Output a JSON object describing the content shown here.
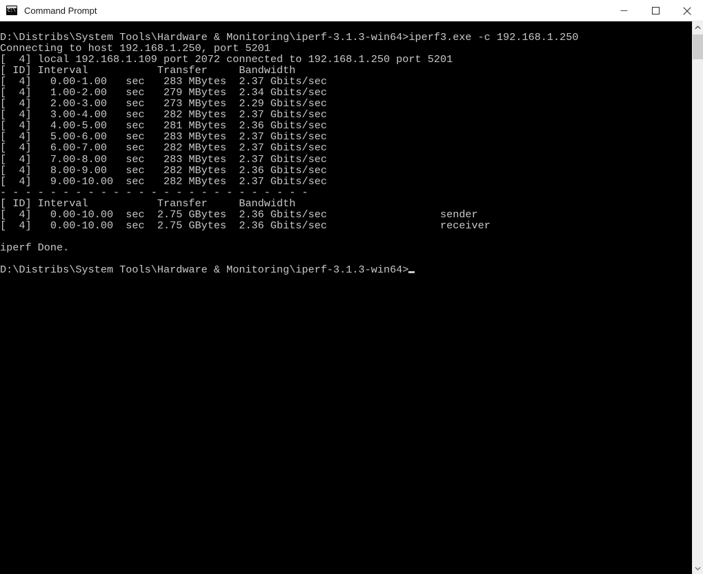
{
  "window": {
    "title": "Command Prompt",
    "icon_name": "command-prompt-icon",
    "icon_glyph": "C:\\",
    "controls": {
      "minimize_label": "Minimize",
      "maximize_label": "Maximize",
      "close_label": "Close"
    },
    "colors": {
      "titlebar_bg": "#ffffff",
      "titlebar_fg": "#1a1a1a",
      "console_bg": "#000000",
      "console_fg": "#c8c8c8",
      "scrollbar_track": "#f0f0f0",
      "scrollbar_thumb": "#cdcdcd"
    }
  },
  "scrollbar": {
    "up_arrow": "⌃",
    "down_arrow": "⌄"
  },
  "terminal": {
    "prompt_path": "D:\\Distribs\\System Tools\\Hardware & Monitoring\\iperf-3.1.3-win64>",
    "command": "iperf3.exe -c 192.168.1.250",
    "cursor_visible": true,
    "lines": [
      "D:\\Distribs\\System Tools\\Hardware & Monitoring\\iperf-3.1.3-win64>iperf3.exe -c 192.168.1.250",
      "Connecting to host 192.168.1.250, port 5201",
      "[  4] local 192.168.1.109 port 2072 connected to 192.168.1.250 port 5201",
      "[ ID] Interval           Transfer     Bandwidth",
      "[  4]   0.00-1.00   sec   283 MBytes  2.37 Gbits/sec",
      "[  4]   1.00-2.00   sec   279 MBytes  2.34 Gbits/sec",
      "[  4]   2.00-3.00   sec   273 MBytes  2.29 Gbits/sec",
      "[  4]   3.00-4.00   sec   282 MBytes  2.37 Gbits/sec",
      "[  4]   4.00-5.00   sec   281 MBytes  2.36 Gbits/sec",
      "[  4]   5.00-6.00   sec   283 MBytes  2.37 Gbits/sec",
      "[  4]   6.00-7.00   sec   282 MBytes  2.37 Gbits/sec",
      "[  4]   7.00-8.00   sec   283 MBytes  2.37 Gbits/sec",
      "[  4]   8.00-9.00   sec   282 MBytes  2.36 Gbits/sec",
      "[  4]   9.00-10.00  sec   282 MBytes  2.37 Gbits/sec",
      "- - - - - - - - - - - - - - - - - - - - - - - - -",
      "[ ID] Interval           Transfer     Bandwidth",
      "[  4]   0.00-10.00  sec  2.75 GBytes  2.36 Gbits/sec                  sender",
      "[  4]   0.00-10.00  sec  2.75 GBytes  2.36 Gbits/sec                  receiver",
      "",
      "iperf Done.",
      "",
      "D:\\Distribs\\System Tools\\Hardware & Monitoring\\iperf-3.1.3-win64>"
    ]
  },
  "iperf_run": {
    "host": "192.168.1.250",
    "server_port": 5201,
    "local_ip": "192.168.1.109",
    "local_port": 2072,
    "stream_id": 4,
    "columns": [
      "ID",
      "Interval",
      "Transfer",
      "Bandwidth"
    ],
    "intervals": [
      {
        "id": 4,
        "interval": "0.00-1.00",
        "unit": "sec",
        "transfer": "283 MBytes",
        "bandwidth": "2.37 Gbits/sec"
      },
      {
        "id": 4,
        "interval": "1.00-2.00",
        "unit": "sec",
        "transfer": "279 MBytes",
        "bandwidth": "2.34 Gbits/sec"
      },
      {
        "id": 4,
        "interval": "2.00-3.00",
        "unit": "sec",
        "transfer": "273 MBytes",
        "bandwidth": "2.29 Gbits/sec"
      },
      {
        "id": 4,
        "interval": "3.00-4.00",
        "unit": "sec",
        "transfer": "282 MBytes",
        "bandwidth": "2.37 Gbits/sec"
      },
      {
        "id": 4,
        "interval": "4.00-5.00",
        "unit": "sec",
        "transfer": "281 MBytes",
        "bandwidth": "2.36 Gbits/sec"
      },
      {
        "id": 4,
        "interval": "5.00-6.00",
        "unit": "sec",
        "transfer": "283 MBytes",
        "bandwidth": "2.37 Gbits/sec"
      },
      {
        "id": 4,
        "interval": "6.00-7.00",
        "unit": "sec",
        "transfer": "282 MBytes",
        "bandwidth": "2.37 Gbits/sec"
      },
      {
        "id": 4,
        "interval": "7.00-8.00",
        "unit": "sec",
        "transfer": "283 MBytes",
        "bandwidth": "2.37 Gbits/sec"
      },
      {
        "id": 4,
        "interval": "8.00-9.00",
        "unit": "sec",
        "transfer": "282 MBytes",
        "bandwidth": "2.36 Gbits/sec"
      },
      {
        "id": 4,
        "interval": "9.00-10.00",
        "unit": "sec",
        "transfer": "282 MBytes",
        "bandwidth": "2.37 Gbits/sec"
      }
    ],
    "summary": [
      {
        "id": 4,
        "interval": "0.00-10.00",
        "unit": "sec",
        "transfer": "2.75 GBytes",
        "bandwidth": "2.36 Gbits/sec",
        "role": "sender"
      },
      {
        "id": 4,
        "interval": "0.00-10.00",
        "unit": "sec",
        "transfer": "2.75 GBytes",
        "bandwidth": "2.36 Gbits/sec",
        "role": "receiver"
      }
    ],
    "done_message": "iperf Done."
  }
}
